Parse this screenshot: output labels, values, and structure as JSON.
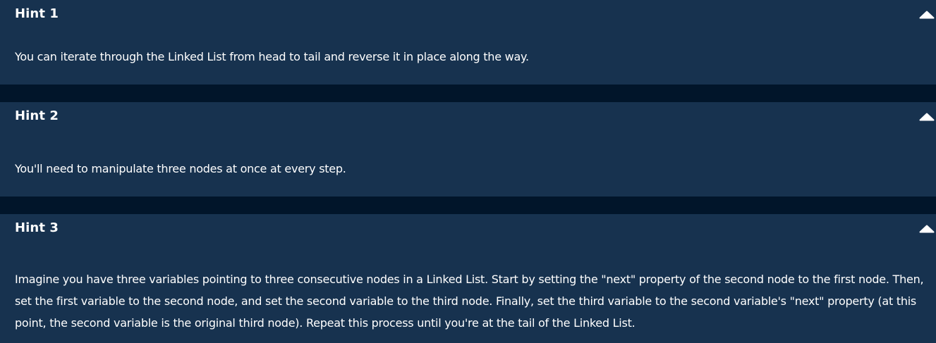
{
  "hints": [
    {
      "title": "Hint 1",
      "body": "You can iterate through the Linked List from head to tail and reverse it in place along the way.",
      "toggle_icon": "chevron-up-icon"
    },
    {
      "title": "Hint 2",
      "body": "You'll need to manipulate three nodes at once at every step.",
      "toggle_icon": "chevron-up-icon"
    },
    {
      "title": "Hint 3",
      "body": "Imagine you have three variables pointing to three consecutive nodes in a Linked List. Start by setting the \"next\" property of the second node to the first node. Then, set the first variable to the second node, and set the second variable to the third node. Finally, set the third variable to the second variable's \"next\" property (at this point, the second variable is the original third node). Repeat this process until you're at the tail of the Linked List.",
      "toggle_icon": "chevron-up-icon"
    }
  ],
  "colors": {
    "page_background": "#01152a",
    "card_background": "#17324f",
    "text": "#ffffff"
  }
}
